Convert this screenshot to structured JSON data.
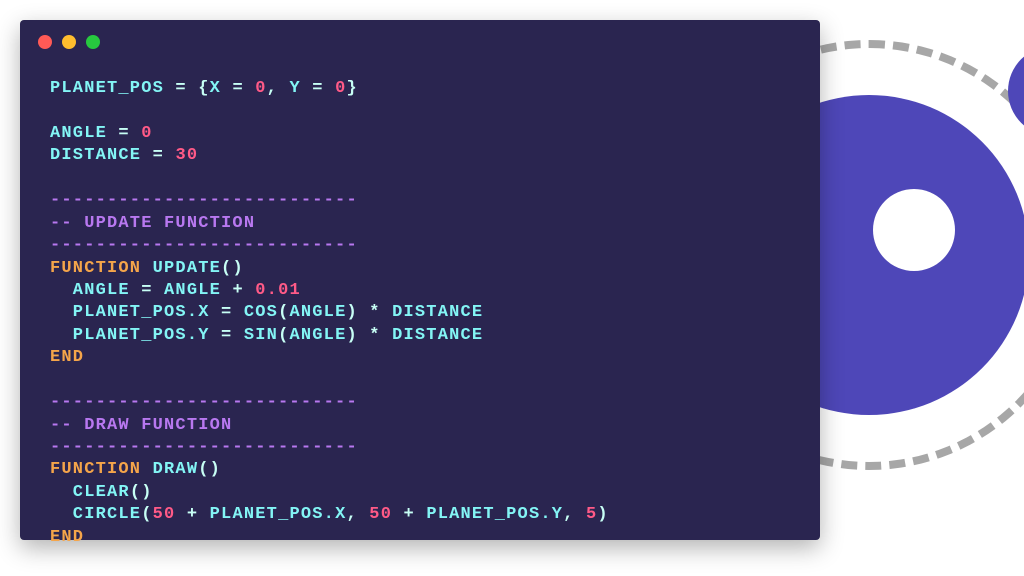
{
  "window": {
    "dots": [
      "#ff5a56",
      "#ffbd2e",
      "#27c93f"
    ]
  },
  "colors": {
    "bg": "#2a2550",
    "accent": "#4e47b8",
    "orbit": "#a7a7a7",
    "cyan": "#83f5f5",
    "pink": "#ff5a87",
    "purple": "#b878f0",
    "orange": "#f5a54a",
    "mint": "#c7fff5"
  },
  "code": {
    "dashes": "---------------------------",
    "lines": [
      {
        "segs": [
          {
            "t": "PLANET_POS",
            "c": "cyan"
          },
          {
            "t": " = {",
            "c": "mint"
          },
          {
            "t": "X",
            "c": "cyan"
          },
          {
            "t": " = ",
            "c": "mint"
          },
          {
            "t": "0",
            "c": "pink"
          },
          {
            "t": ", ",
            "c": "mint"
          },
          {
            "t": "Y",
            "c": "cyan"
          },
          {
            "t": " = ",
            "c": "mint"
          },
          {
            "t": "0",
            "c": "pink"
          },
          {
            "t": "}",
            "c": "mint"
          }
        ]
      },
      {
        "blank": true
      },
      {
        "segs": [
          {
            "t": "ANGLE",
            "c": "cyan"
          },
          {
            "t": " = ",
            "c": "mint"
          },
          {
            "t": "0",
            "c": "pink"
          }
        ]
      },
      {
        "segs": [
          {
            "t": "DISTANCE",
            "c": "cyan"
          },
          {
            "t": " = ",
            "c": "mint"
          },
          {
            "t": "30",
            "c": "pink"
          }
        ]
      },
      {
        "blank": true
      },
      {
        "dash": true
      },
      {
        "segs": [
          {
            "t": "-- UPDATE FUNCTION",
            "c": "purple"
          }
        ]
      },
      {
        "dash": true
      },
      {
        "segs": [
          {
            "t": "FUNCTION",
            "c": "orange"
          },
          {
            "t": " ",
            "c": "mint"
          },
          {
            "t": "UPDATE",
            "c": "cyan"
          },
          {
            "t": "()",
            "c": "mint"
          }
        ]
      },
      {
        "segs": [
          {
            "t": "  ANGLE",
            "c": "cyan"
          },
          {
            "t": " = ",
            "c": "mint"
          },
          {
            "t": "ANGLE",
            "c": "cyan"
          },
          {
            "t": " + ",
            "c": "mint"
          },
          {
            "t": "0.01",
            "c": "pink"
          }
        ]
      },
      {
        "segs": [
          {
            "t": "  PLANET_POS.X",
            "c": "cyan"
          },
          {
            "t": " = ",
            "c": "mint"
          },
          {
            "t": "COS",
            "c": "cyan"
          },
          {
            "t": "(",
            "c": "mint"
          },
          {
            "t": "ANGLE",
            "c": "cyan"
          },
          {
            "t": ") * ",
            "c": "mint"
          },
          {
            "t": "DISTANCE",
            "c": "cyan"
          }
        ]
      },
      {
        "segs": [
          {
            "t": "  PLANET_POS.Y",
            "c": "cyan"
          },
          {
            "t": " = ",
            "c": "mint"
          },
          {
            "t": "SIN",
            "c": "cyan"
          },
          {
            "t": "(",
            "c": "mint"
          },
          {
            "t": "ANGLE",
            "c": "cyan"
          },
          {
            "t": ") * ",
            "c": "mint"
          },
          {
            "t": "DISTANCE",
            "c": "cyan"
          }
        ]
      },
      {
        "segs": [
          {
            "t": "END",
            "c": "orange"
          }
        ]
      },
      {
        "blank": true
      },
      {
        "dash": true
      },
      {
        "segs": [
          {
            "t": "-- DRAW FUNCTION",
            "c": "purple"
          }
        ]
      },
      {
        "dash": true
      },
      {
        "segs": [
          {
            "t": "FUNCTION",
            "c": "orange"
          },
          {
            "t": " ",
            "c": "mint"
          },
          {
            "t": "DRAW",
            "c": "cyan"
          },
          {
            "t": "()",
            "c": "mint"
          }
        ]
      },
      {
        "segs": [
          {
            "t": "  CLEAR",
            "c": "cyan"
          },
          {
            "t": "()",
            "c": "mint"
          }
        ]
      },
      {
        "segs": [
          {
            "t": "  CIRCLE",
            "c": "cyan"
          },
          {
            "t": "(",
            "c": "mint"
          },
          {
            "t": "50",
            "c": "pink"
          },
          {
            "t": " + ",
            "c": "mint"
          },
          {
            "t": "PLANET_POS.X",
            "c": "cyan"
          },
          {
            "t": ", ",
            "c": "mint"
          },
          {
            "t": "50",
            "c": "pink"
          },
          {
            "t": " + ",
            "c": "mint"
          },
          {
            "t": "PLANET_POS.Y",
            "c": "cyan"
          },
          {
            "t": ", ",
            "c": "mint"
          },
          {
            "t": "5",
            "c": "pink"
          },
          {
            "t": ")",
            "c": "mint"
          }
        ]
      },
      {
        "segs": [
          {
            "t": "END",
            "c": "orange"
          }
        ]
      }
    ]
  }
}
